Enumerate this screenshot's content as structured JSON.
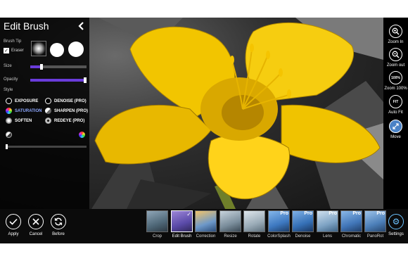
{
  "panel": {
    "title": "Edit Brush",
    "brush_tip_label": "Brush Tip",
    "eraser_label": "Eraser",
    "eraser_checked": true,
    "size_label": "Size",
    "size_value": 0.2,
    "opacity_label": "Opacity",
    "opacity_value": 1.0,
    "style_label": "Style",
    "styles": {
      "exposure": "EXPOSURE",
      "denoise": "DENOISE (PRO)",
      "saturation": "SATURATION",
      "sharpen": "SHARPEN (PRO)",
      "soften": "SOFTEN",
      "redeye": "REDEYE (PRO)"
    },
    "selected_style": "SATURATION",
    "strength_value": 0.0
  },
  "rail": {
    "zoom_in": "Zoom In",
    "zoom_out": "Zoom out",
    "zoom_100_icon_text": "100%",
    "zoom_100": "Zoom 100%",
    "fit_icon_text": "FIT",
    "auto_fit": "Auto Fit",
    "move": "Move"
  },
  "actions": {
    "apply": "Apply",
    "cancel": "Cancel",
    "before": "Before"
  },
  "tools": [
    {
      "label": "Crop",
      "pro": false,
      "selected": false
    },
    {
      "label": "Edit Brush",
      "pro": false,
      "selected": true
    },
    {
      "label": "Correction",
      "pro": false,
      "selected": false
    },
    {
      "label": "Resize",
      "pro": false,
      "selected": false
    },
    {
      "label": "Rotate",
      "pro": false,
      "selected": false
    },
    {
      "label": "ColorSplash",
      "pro": true,
      "selected": false
    },
    {
      "label": "Denoise",
      "pro": true,
      "selected": false
    },
    {
      "label": "Lens",
      "pro": true,
      "selected": false
    },
    {
      "label": "Chromatic",
      "pro": true,
      "selected": false
    },
    {
      "label": "PanoRot",
      "pro": true,
      "selected": false
    }
  ],
  "pro_badge": "Pro",
  "settings": "Settings",
  "colors": {
    "accent": "#6a3cdb",
    "flower": "#f2c500",
    "settings_accent": "#6cc3ff",
    "move_accent": "#4a82c6"
  }
}
